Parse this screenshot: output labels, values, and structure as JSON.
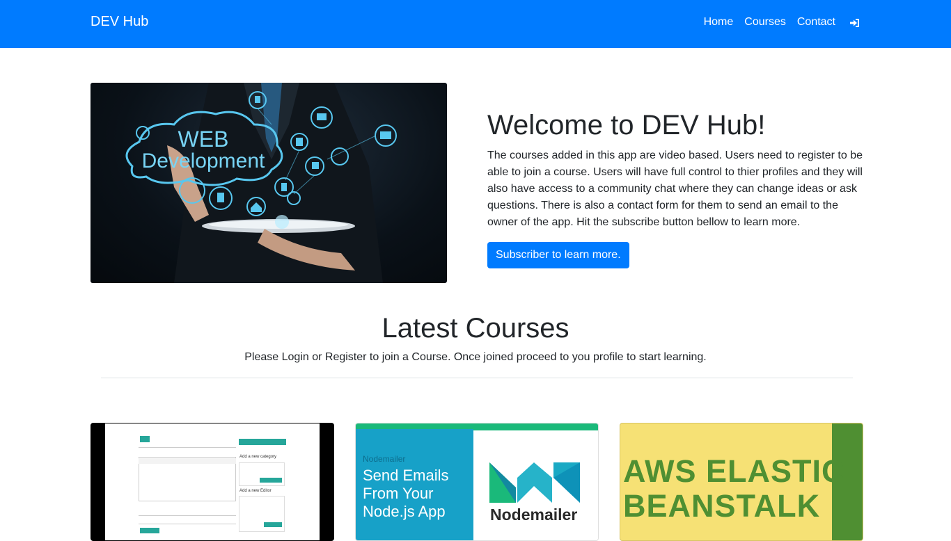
{
  "navbar": {
    "brand": "DEV Hub",
    "links": [
      "Home",
      "Courses",
      "Contact"
    ],
    "login_icon": "sign-in-icon",
    "color": "#007bff"
  },
  "hero": {
    "image_text": [
      "WEB",
      "Development"
    ],
    "title": "Welcome to DEV Hub!",
    "description": "The courses added in this app are video based. Users need to register to be able to join a course. Users will have full control to thier profiles and they will also have access to a community chat where they can change ideas or ask questions. There is also a contact form for them to send an email to the owner of the app. Hit the subscribe button bellow to learn more.",
    "button": "Subscriber to learn more."
  },
  "latest": {
    "title": "Latest Courses",
    "subtitle": "Please Login or Register to join a Course. Once joined proceed to you profile to start learning."
  },
  "courses": [
    {
      "screenshot_labels": [
        "Add a new category",
        "Add a new Editor"
      ]
    },
    {
      "tag": "Nodemailer",
      "headline": "Send Emails From Your Node.js App",
      "logo": "Nodemailer"
    },
    {
      "line1": "AWS ELASTIC",
      "line2": "BEANSTALK"
    }
  ]
}
